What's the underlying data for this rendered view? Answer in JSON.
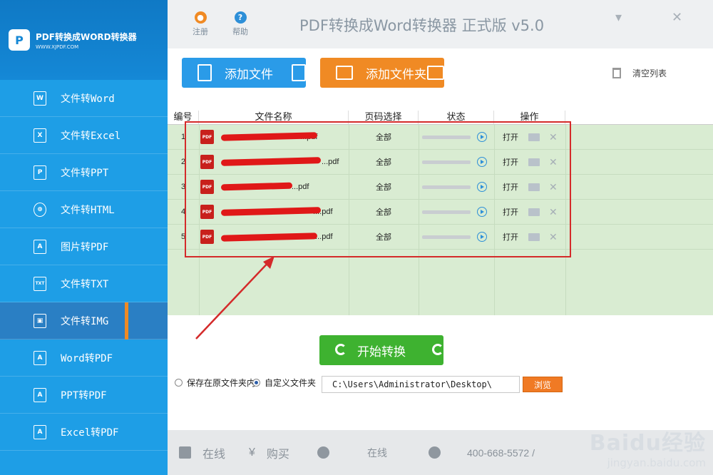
{
  "brand": {
    "logo": "P",
    "name": "PDF转换成WORD转换器",
    "url": "WWW.XJPDF.COM"
  },
  "sidebar": {
    "items": [
      {
        "label": "文件转Word",
        "icon": "W"
      },
      {
        "label": "文件转Excel",
        "icon": "X"
      },
      {
        "label": "文件转PPT",
        "icon": "P"
      },
      {
        "label": "文件转HTML",
        "icon": "⊕"
      },
      {
        "label": "图片转PDF",
        "icon": "A"
      },
      {
        "label": "文件转TXT",
        "icon": "TXT"
      },
      {
        "label": "文件转IMG",
        "icon": "▣"
      },
      {
        "label": "Word转PDF",
        "icon": "A"
      },
      {
        "label": "PPT转PDF",
        "icon": "A"
      },
      {
        "label": "Excel转PDF",
        "icon": "A"
      }
    ],
    "active_index": 6
  },
  "titlebar": {
    "register_label": "注册",
    "help_label": "帮助",
    "title": "PDF转换成Word转换器 正式版 v5.0",
    "minimize": "▾",
    "close": "✕"
  },
  "toolbar": {
    "add_file": "添加文件",
    "add_folder": "添加文件夹",
    "clear_list": "清空列表"
  },
  "table": {
    "headers": [
      "编号",
      "文件名称",
      "页码选择",
      "状态",
      "操作"
    ],
    "rows": [
      {
        "num": "1",
        "name": "...pdf",
        "pages": "全部",
        "open": "打开"
      },
      {
        "num": "2",
        "name": "...pdf",
        "pages": "全部",
        "open": "打开"
      },
      {
        "num": "3",
        "name": "...pdf",
        "pages": "全部",
        "open": "打开"
      },
      {
        "num": "4",
        "name": "....pdf",
        "pages": "全部",
        "open": "打开"
      },
      {
        "num": "5",
        "name": "....pdf",
        "pages": "全部",
        "open": "打开"
      }
    ]
  },
  "pdf_icon_text": "PDF",
  "start_button": "开始转换",
  "save": {
    "option_original": "保存在原文件夹内",
    "option_custom": "自定义文件夹",
    "path": "C:\\Users\\Administrator\\Desktop\\",
    "browse": "浏览"
  },
  "footer": {
    "online_service": "在线",
    "buy": "购买",
    "online": "在线",
    "phone": "400-668-5572 /"
  },
  "watermark": {
    "logo": "Baidu经验",
    "url": "jingyan.baidu.com"
  },
  "colors": {
    "sidebar": "#1e9ee6",
    "add_file": "#2a9be8",
    "add_folder": "#f08a24",
    "start": "#3eb230",
    "table_bg": "#d9ecd2",
    "annotation": "#d42a2a"
  }
}
